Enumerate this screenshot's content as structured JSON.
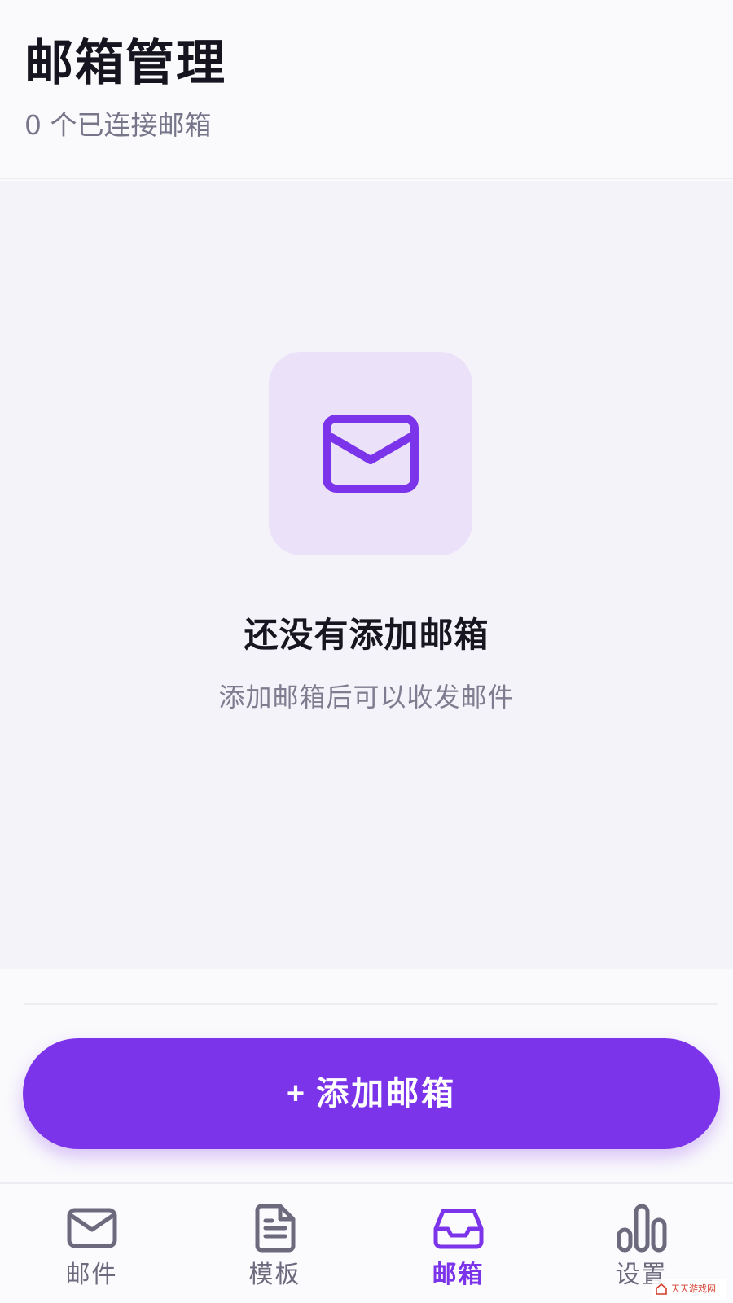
{
  "header": {
    "title": "邮箱管理",
    "subtitle": "0 个已连接邮箱"
  },
  "empty_state": {
    "icon": "mail-icon",
    "title": "还没有添加邮箱",
    "description": "添加邮箱后可以收发邮件"
  },
  "add_button": {
    "plus": "+",
    "label": "添加邮箱"
  },
  "bottom_nav": {
    "active": "mailbox",
    "items": [
      {
        "id": "mail",
        "icon": "mail-icon",
        "label": "邮件"
      },
      {
        "id": "templates",
        "icon": "document-icon",
        "label": "模板"
      },
      {
        "id": "mailbox",
        "icon": "inbox-icon",
        "label": "邮箱"
      },
      {
        "id": "settings",
        "icon": "bar-chart-icon",
        "label": "设置"
      }
    ]
  },
  "watermark": {
    "text": "天天游戏网"
  },
  "colors": {
    "accent": "#7c34ea",
    "icon_tile_bg": "#ebe1f8",
    "content_bg": "#f5f3fa",
    "text_primary": "#16141f",
    "text_secondary": "#77758a",
    "nav_inactive": "#6d6a7e"
  }
}
